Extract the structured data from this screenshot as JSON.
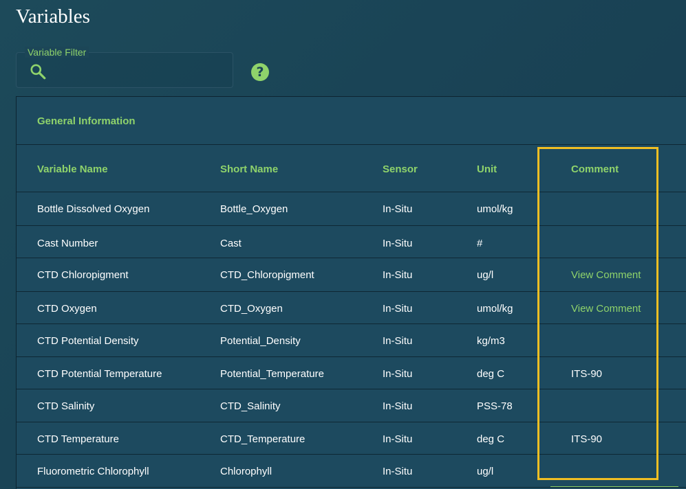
{
  "page": {
    "title": "Variables"
  },
  "filter": {
    "legend": "Variable Filter",
    "value": "",
    "icon": "search-icon"
  },
  "help": {
    "icon": "help-icon",
    "glyph": "?"
  },
  "colors": {
    "accent": "#8fd36b",
    "highlight": "#f1bf23",
    "table_bg": "#1d4a5f"
  },
  "table": {
    "section_title": "General Information",
    "columns": [
      "Variable Name",
      "Short Name",
      "Sensor",
      "Unit",
      "Comment"
    ],
    "rows": [
      {
        "name": "Bottle Dissolved Oxygen",
        "short": "Bottle_Oxygen",
        "sensor": "In-Situ",
        "unit": "umol/kg",
        "comment": "",
        "comment_link": false
      },
      {
        "name": "Cast Number",
        "short": "Cast",
        "sensor": "In-Situ",
        "unit": "#",
        "comment": "",
        "comment_link": false
      },
      {
        "name": "CTD Chloropigment",
        "short": "CTD_Chloropigment",
        "sensor": "In-Situ",
        "unit": "ug/l",
        "comment": "View Comment",
        "comment_link": true
      },
      {
        "name": "CTD Oxygen",
        "short": "CTD_Oxygen",
        "sensor": "In-Situ",
        "unit": "umol/kg",
        "comment": "View Comment",
        "comment_link": true
      },
      {
        "name": "CTD Potential Density",
        "short": "Potential_Density",
        "sensor": "In-Situ",
        "unit": "kg/m3",
        "comment": "",
        "comment_link": false
      },
      {
        "name": "CTD Potential Temperature",
        "short": "Potential_Temperature",
        "sensor": "In-Situ",
        "unit": "deg C",
        "comment": "ITS-90",
        "comment_link": false
      },
      {
        "name": "CTD Salinity",
        "short": "CTD_Salinity",
        "sensor": "In-Situ",
        "unit": "PSS-78",
        "comment": "",
        "comment_link": false
      },
      {
        "name": "CTD Temperature",
        "short": "CTD_Temperature",
        "sensor": "In-Situ",
        "unit": "deg C",
        "comment": "ITS-90",
        "comment_link": false
      },
      {
        "name": "Fluorometric Chlorophyll",
        "short": "Chlorophyll",
        "sensor": "In-Situ",
        "unit": "ug/l",
        "comment": "",
        "comment_link": false
      }
    ]
  }
}
